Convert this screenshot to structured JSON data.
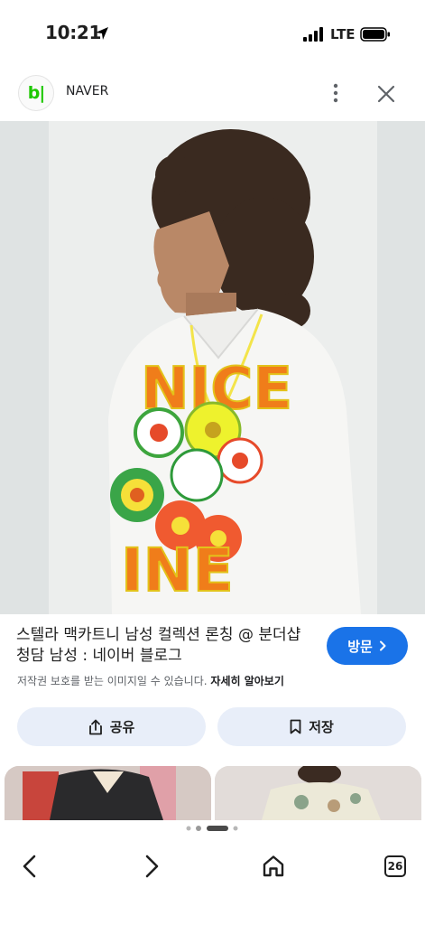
{
  "status_bar": {
    "time": "10:21",
    "network": "LTE"
  },
  "source": {
    "logo_text": "b|",
    "name": "NAVER"
  },
  "caption": {
    "title": "스텔라 맥카트니 남성 컬렉션 론칭 @ 분더샵 청담 남성 : 네이버 블로그",
    "copyright_text": "저작권 보호를 받는 이미지일 수 있습니다.",
    "learn_more": "자세히 알아보기"
  },
  "buttons": {
    "visit": "방문",
    "share": "공유",
    "save": "저장"
  },
  "image": {
    "shirt_print_top": "NICE",
    "shirt_print_bottom": "INE"
  },
  "toolbar": {
    "tabs_count": "26"
  },
  "colors": {
    "accent": "#1a73e8",
    "chip_bg": "#e8eef9",
    "naver_green": "#1ec800"
  }
}
